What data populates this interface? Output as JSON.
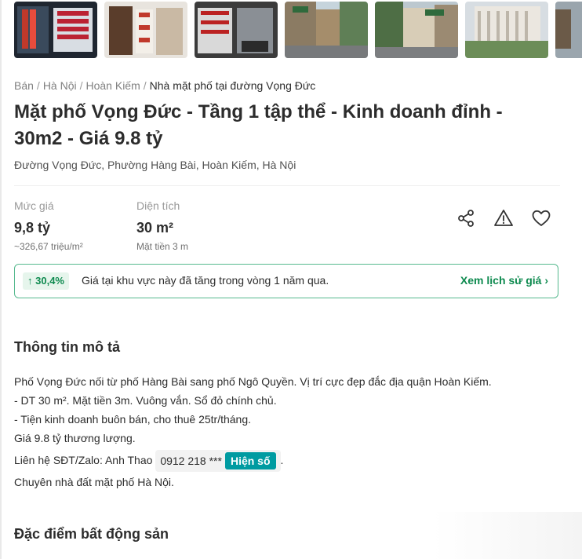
{
  "breadcrumb": [
    {
      "label": "Bán"
    },
    {
      "label": "Hà Nội"
    },
    {
      "label": "Hoàn Kiếm"
    },
    {
      "label": "Nhà mặt phố tại đường Vọng Đức"
    }
  ],
  "listing": {
    "title": "Mặt phố Vọng Đức - Tầng 1 tập thể - Kinh doanh đỉnh - 30m2 - Giá 9.8 tỷ",
    "address": "Đường Vọng Đức, Phường Hàng Bài, Hoàn Kiếm, Hà Nội"
  },
  "metrics": {
    "price": {
      "label": "Mức giá",
      "value": "9,8 tỷ",
      "sub": "~326,67 triệu/m²"
    },
    "area": {
      "label": "Diện tích",
      "value": "30 m²",
      "sub": "Mặt tiền 3 m"
    }
  },
  "actions": {
    "share_icon": "share-icon",
    "report_icon": "warning-icon",
    "save_icon": "heart-icon"
  },
  "price_trend": {
    "badge": "30,4%",
    "text": "Giá tại khu vực này đã tăng trong vòng 1 năm qua.",
    "link": "Xem lịch sử giá"
  },
  "description": {
    "heading": "Thông tin mô tả",
    "lines": [
      "Phố Vọng Đức nối từ phố Hàng Bài sang phố Ngô Quyền. Vị trí cực đẹp đắc địa quận Hoàn Kiếm.",
      "- DT 30 m². Mặt tiền 3m. Vuông vắn. Sổ đỏ chính chủ.",
      "- Tiện kinh doanh buôn bán, cho thuê 25tr/tháng.",
      "Giá 9.8 tỷ thương lượng."
    ],
    "contact_prefix": "Liên hệ SĐT/Zalo: Anh Thao",
    "phone_masked": "0912 218 ***",
    "reveal_label": "Hiện số",
    "contact_suffix": ".",
    "closing": "Chuyên nhà đất mặt phố Hà Nội."
  },
  "features": {
    "heading": "Đặc điểm bất động sản"
  },
  "colors": {
    "accent_green": "#0e8a4f",
    "trend_border": "#56b98e",
    "reveal_button": "#009ba1"
  }
}
